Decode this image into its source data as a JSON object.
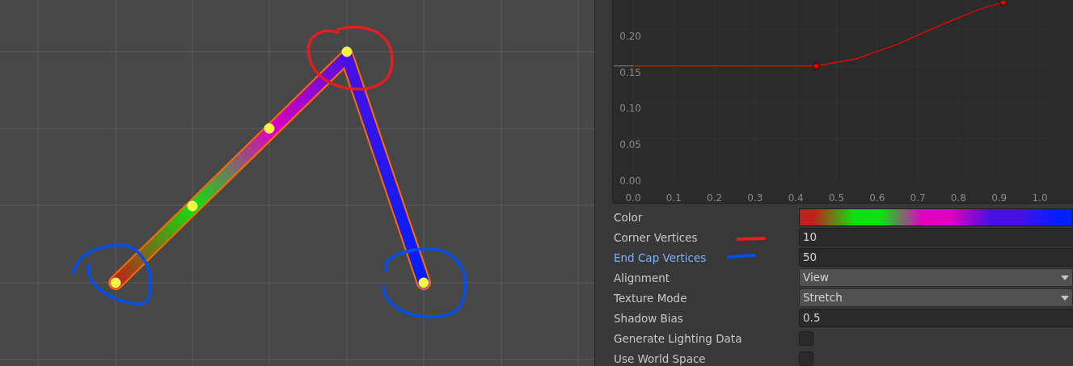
{
  "scene": {
    "annotations": [
      {
        "kind": "circle",
        "color": "#e41e1e"
      },
      {
        "kind": "circle",
        "color": "#0050f0"
      },
      {
        "kind": "circle",
        "color": "#0050f0"
      },
      {
        "kind": "dash",
        "color": "#e41e1e"
      },
      {
        "kind": "dash",
        "color": "#0050f0"
      }
    ]
  },
  "curve": {
    "chart_data": {
      "type": "line",
      "x": [
        0,
        0.45,
        0.55,
        0.65,
        0.75,
        0.85,
        0.91
      ],
      "series": [
        {
          "color": "#ff0000",
          "values": [
            0.15,
            0.15,
            0.16,
            0.18,
            0.205,
            0.228,
            0.238
          ]
        }
      ],
      "grid": true,
      "xlim": [
        0,
        1
      ],
      "ylim": [
        0,
        0.24
      ],
      "xticks": [
        {
          "value": 0,
          "label": "0.0"
        },
        {
          "value": 0.1,
          "label": "0.1"
        },
        {
          "value": 0.2,
          "label": "0.2"
        },
        {
          "value": 0.3,
          "label": "0.3"
        },
        {
          "value": 0.4,
          "label": "0.4"
        },
        {
          "value": 0.5,
          "label": "0.5"
        },
        {
          "value": 0.6,
          "label": "0.6"
        },
        {
          "value": 0.7,
          "label": "0.7"
        },
        {
          "value": 0.8,
          "label": "0.8"
        },
        {
          "value": 0.9,
          "label": "0.9"
        },
        {
          "value": 1,
          "label": "1.0"
        }
      ],
      "yticks": [
        {
          "value": 0,
          "label": "0.00"
        },
        {
          "value": 0.05,
          "label": "0.05"
        },
        {
          "value": 0.1,
          "label": "0.10"
        },
        {
          "value": 0.15,
          "label": "0.15"
        },
        {
          "value": 0.2,
          "label": "0.20"
        }
      ]
    }
  },
  "properties": [
    {
      "label": "Color",
      "kind": "gradient",
      "highlighted": false,
      "stops": [
        {
          "color": "#c0201a"
        },
        {
          "color": "#10e010"
        },
        {
          "color": "#e000c0"
        },
        {
          "color": "#4a10e0"
        },
        {
          "color": "#0020ff"
        }
      ]
    },
    {
      "label": "Corner Vertices",
      "kind": "number",
      "highlighted": false,
      "value": "10"
    },
    {
      "label": "End Cap Vertices",
      "kind": "number",
      "highlighted": true,
      "value": "50"
    },
    {
      "label": "Alignment",
      "kind": "dropdown",
      "highlighted": false,
      "value": "View"
    },
    {
      "label": "Texture Mode",
      "kind": "dropdown",
      "highlighted": false,
      "value": "Stretch"
    },
    {
      "label": "Shadow Bias",
      "kind": "number",
      "highlighted": false,
      "value": "0.5"
    },
    {
      "label": "Generate Lighting Data",
      "kind": "checkbox",
      "highlighted": false,
      "checked": false
    },
    {
      "label": "Use World Space",
      "kind": "checkbox",
      "highlighted": false,
      "checked": false
    }
  ]
}
